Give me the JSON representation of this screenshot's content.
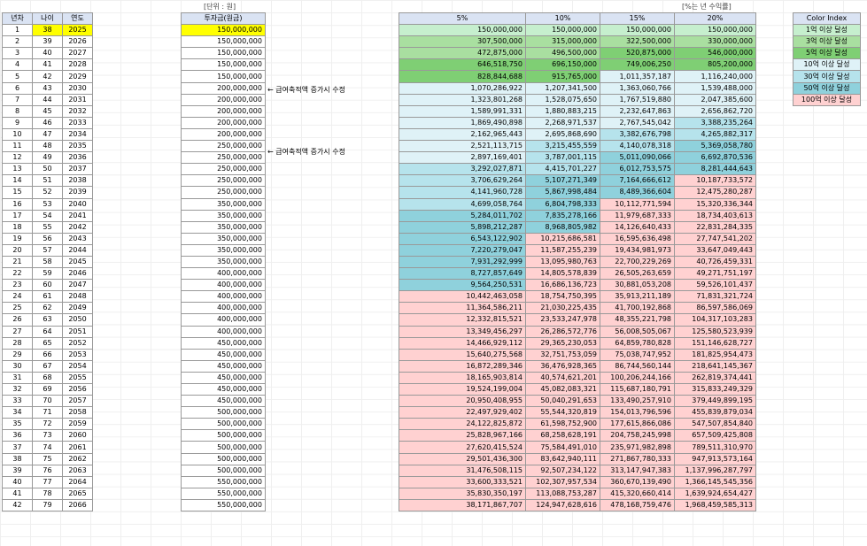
{
  "unit_label": "[단위 : 원]",
  "rate_label": "[%는 년 수익률]",
  "left_headers": [
    "년차",
    "나이",
    "연도"
  ],
  "invest_header": "투자금(원금)",
  "rate_headers": [
    "5%",
    "10%",
    "15%",
    "20%"
  ],
  "notes": [
    "← 급여축적액 증가시 수정",
    "← 급여축적액 증가시 수정"
  ],
  "color_index": {
    "title": "Color Index",
    "items": [
      "1억 이상 달성",
      "3억 이상 달성",
      "5억 이상 달성",
      "10억 이상 달성",
      "30억 이상 달성",
      "50억 이상 달성",
      "100억 이상 달성"
    ],
    "colors": [
      "#c6efce",
      "#a9dfa0",
      "#7fcf74",
      "#dff2f7",
      "#b6e3ec",
      "#8fd1dc",
      "#ffd1d1"
    ]
  },
  "rows": [
    {
      "n": "1",
      "age": "38",
      "year": "2025",
      "inv": "150,000,000",
      "v": [
        "150,000,000",
        "150,000,000",
        "150,000,000",
        "150,000,000"
      ]
    },
    {
      "n": "2",
      "age": "39",
      "year": "2026",
      "inv": "150,000,000",
      "v": [
        "307,500,000",
        "315,000,000",
        "322,500,000",
        "330,000,000"
      ]
    },
    {
      "n": "3",
      "age": "40",
      "year": "2027",
      "inv": "150,000,000",
      "v": [
        "472,875,000",
        "496,500,000",
        "520,875,000",
        "546,000,000"
      ]
    },
    {
      "n": "4",
      "age": "41",
      "year": "2028",
      "inv": "150,000,000",
      "v": [
        "646,518,750",
        "696,150,000",
        "749,006,250",
        "805,200,000"
      ]
    },
    {
      "n": "5",
      "age": "42",
      "year": "2029",
      "inv": "150,000,000",
      "v": [
        "828,844,688",
        "915,765,000",
        "1,011,357,187",
        "1,116,240,000"
      ]
    },
    {
      "n": "6",
      "age": "43",
      "year": "2030",
      "inv": "200,000,000",
      "v": [
        "1,070,286,922",
        "1,207,341,500",
        "1,363,060,766",
        "1,539,488,000"
      ]
    },
    {
      "n": "7",
      "age": "44",
      "year": "2031",
      "inv": "200,000,000",
      "v": [
        "1,323,801,268",
        "1,528,075,650",
        "1,767,519,880",
        "2,047,385,600"
      ]
    },
    {
      "n": "8",
      "age": "45",
      "year": "2032",
      "inv": "200,000,000",
      "v": [
        "1,589,991,331",
        "1,880,883,215",
        "2,232,647,863",
        "2,656,862,720"
      ]
    },
    {
      "n": "9",
      "age": "46",
      "year": "2033",
      "inv": "200,000,000",
      "v": [
        "1,869,490,898",
        "2,268,971,537",
        "2,767,545,042",
        "3,388,235,264"
      ]
    },
    {
      "n": "10",
      "age": "47",
      "year": "2034",
      "inv": "200,000,000",
      "v": [
        "2,162,965,443",
        "2,695,868,690",
        "3,382,676,798",
        "4,265,882,317"
      ]
    },
    {
      "n": "11",
      "age": "48",
      "year": "2035",
      "inv": "250,000,000",
      "v": [
        "2,521,113,715",
        "3,215,455,559",
        "4,140,078,318",
        "5,369,058,780"
      ]
    },
    {
      "n": "12",
      "age": "49",
      "year": "2036",
      "inv": "250,000,000",
      "v": [
        "2,897,169,401",
        "3,787,001,115",
        "5,011,090,066",
        "6,692,870,536"
      ]
    },
    {
      "n": "13",
      "age": "50",
      "year": "2037",
      "inv": "250,000,000",
      "v": [
        "3,292,027,871",
        "4,415,701,227",
        "6,012,753,575",
        "8,281,444,643"
      ]
    },
    {
      "n": "14",
      "age": "51",
      "year": "2038",
      "inv": "250,000,000",
      "v": [
        "3,706,629,264",
        "5,107,271,349",
        "7,164,666,612",
        "10,187,733,572"
      ]
    },
    {
      "n": "15",
      "age": "52",
      "year": "2039",
      "inv": "250,000,000",
      "v": [
        "4,141,960,728",
        "5,867,998,484",
        "8,489,366,604",
        "12,475,280,287"
      ]
    },
    {
      "n": "16",
      "age": "53",
      "year": "2040",
      "inv": "350,000,000",
      "v": [
        "4,699,058,764",
        "6,804,798,333",
        "10,112,771,594",
        "15,320,336,344"
      ]
    },
    {
      "n": "17",
      "age": "54",
      "year": "2041",
      "inv": "350,000,000",
      "v": [
        "5,284,011,702",
        "7,835,278,166",
        "11,979,687,333",
        "18,734,403,613"
      ]
    },
    {
      "n": "18",
      "age": "55",
      "year": "2042",
      "inv": "350,000,000",
      "v": [
        "5,898,212,287",
        "8,968,805,982",
        "14,126,640,433",
        "22,831,284,335"
      ]
    },
    {
      "n": "19",
      "age": "56",
      "year": "2043",
      "inv": "350,000,000",
      "v": [
        "6,543,122,902",
        "10,215,686,581",
        "16,595,636,498",
        "27,747,541,202"
      ]
    },
    {
      "n": "20",
      "age": "57",
      "year": "2044",
      "inv": "350,000,000",
      "v": [
        "7,220,279,047",
        "11,587,255,239",
        "19,434,981,973",
        "33,647,049,443"
      ]
    },
    {
      "n": "21",
      "age": "58",
      "year": "2045",
      "inv": "350,000,000",
      "v": [
        "7,931,292,999",
        "13,095,980,763",
        "22,700,229,269",
        "40,726,459,331"
      ]
    },
    {
      "n": "22",
      "age": "59",
      "year": "2046",
      "inv": "400,000,000",
      "v": [
        "8,727,857,649",
        "14,805,578,839",
        "26,505,263,659",
        "49,271,751,197"
      ]
    },
    {
      "n": "23",
      "age": "60",
      "year": "2047",
      "inv": "400,000,000",
      "v": [
        "9,564,250,531",
        "16,686,136,723",
        "30,881,053,208",
        "59,526,101,437"
      ]
    },
    {
      "n": "24",
      "age": "61",
      "year": "2048",
      "inv": "400,000,000",
      "v": [
        "10,442,463,058",
        "18,754,750,395",
        "35,913,211,189",
        "71,831,321,724"
      ]
    },
    {
      "n": "25",
      "age": "62",
      "year": "2049",
      "inv": "400,000,000",
      "v": [
        "11,364,586,211",
        "21,030,225,435",
        "41,700,192,868",
        "86,597,586,069"
      ]
    },
    {
      "n": "26",
      "age": "63",
      "year": "2050",
      "inv": "400,000,000",
      "v": [
        "12,332,815,521",
        "23,533,247,978",
        "48,355,221,798",
        "104,317,103,283"
      ]
    },
    {
      "n": "27",
      "age": "64",
      "year": "2051",
      "inv": "400,000,000",
      "v": [
        "13,349,456,297",
        "26,286,572,776",
        "56,008,505,067",
        "125,580,523,939"
      ]
    },
    {
      "n": "28",
      "age": "65",
      "year": "2052",
      "inv": "450,000,000",
      "v": [
        "14,466,929,112",
        "29,365,230,053",
        "64,859,780,828",
        "151,146,628,727"
      ]
    },
    {
      "n": "29",
      "age": "66",
      "year": "2053",
      "inv": "450,000,000",
      "v": [
        "15,640,275,568",
        "32,751,753,059",
        "75,038,747,952",
        "181,825,954,473"
      ]
    },
    {
      "n": "30",
      "age": "67",
      "year": "2054",
      "inv": "450,000,000",
      "v": [
        "16,872,289,346",
        "36,476,928,365",
        "86,744,560,144",
        "218,641,145,367"
      ]
    },
    {
      "n": "31",
      "age": "68",
      "year": "2055",
      "inv": "450,000,000",
      "v": [
        "18,165,903,814",
        "40,574,621,201",
        "100,206,244,166",
        "262,819,374,441"
      ]
    },
    {
      "n": "32",
      "age": "69",
      "year": "2056",
      "inv": "450,000,000",
      "v": [
        "19,524,199,004",
        "45,082,083,321",
        "115,687,180,791",
        "315,833,249,329"
      ]
    },
    {
      "n": "33",
      "age": "70",
      "year": "2057",
      "inv": "450,000,000",
      "v": [
        "20,950,408,955",
        "50,040,291,653",
        "133,490,257,910",
        "379,449,899,195"
      ]
    },
    {
      "n": "34",
      "age": "71",
      "year": "2058",
      "inv": "500,000,000",
      "v": [
        "22,497,929,402",
        "55,544,320,819",
        "154,013,796,596",
        "455,839,879,034"
      ]
    },
    {
      "n": "35",
      "age": "72",
      "year": "2059",
      "inv": "500,000,000",
      "v": [
        "24,122,825,872",
        "61,598,752,900",
        "177,615,866,086",
        "547,507,854,840"
      ]
    },
    {
      "n": "36",
      "age": "73",
      "year": "2060",
      "inv": "500,000,000",
      "v": [
        "25,828,967,166",
        "68,258,628,191",
        "204,758,245,998",
        "657,509,425,808"
      ]
    },
    {
      "n": "37",
      "age": "74",
      "year": "2061",
      "inv": "500,000,000",
      "v": [
        "27,620,415,524",
        "75,584,491,010",
        "235,971,982,898",
        "789,511,310,970"
      ]
    },
    {
      "n": "38",
      "age": "75",
      "year": "2062",
      "inv": "500,000,000",
      "v": [
        "29,501,436,300",
        "83,642,940,111",
        "271,867,780,333",
        "947,913,573,164"
      ]
    },
    {
      "n": "39",
      "age": "76",
      "year": "2063",
      "inv": "500,000,000",
      "v": [
        "31,476,508,115",
        "92,507,234,122",
        "313,147,947,383",
        "1,137,996,287,797"
      ]
    },
    {
      "n": "40",
      "age": "77",
      "year": "2064",
      "inv": "550,000,000",
      "v": [
        "33,600,333,521",
        "102,307,957,534",
        "360,670,139,490",
        "1,366,145,545,356"
      ]
    },
    {
      "n": "41",
      "age": "78",
      "year": "2065",
      "inv": "550,000,000",
      "v": [
        "35,830,350,197",
        "113,088,753,287",
        "415,320,660,414",
        "1,639,924,654,427"
      ]
    },
    {
      "n": "42",
      "age": "79",
      "year": "2066",
      "inv": "550,000,000",
      "v": [
        "38,171,867,707",
        "124,947,628,616",
        "478,168,759,476",
        "1,968,459,585,313"
      ]
    }
  ]
}
